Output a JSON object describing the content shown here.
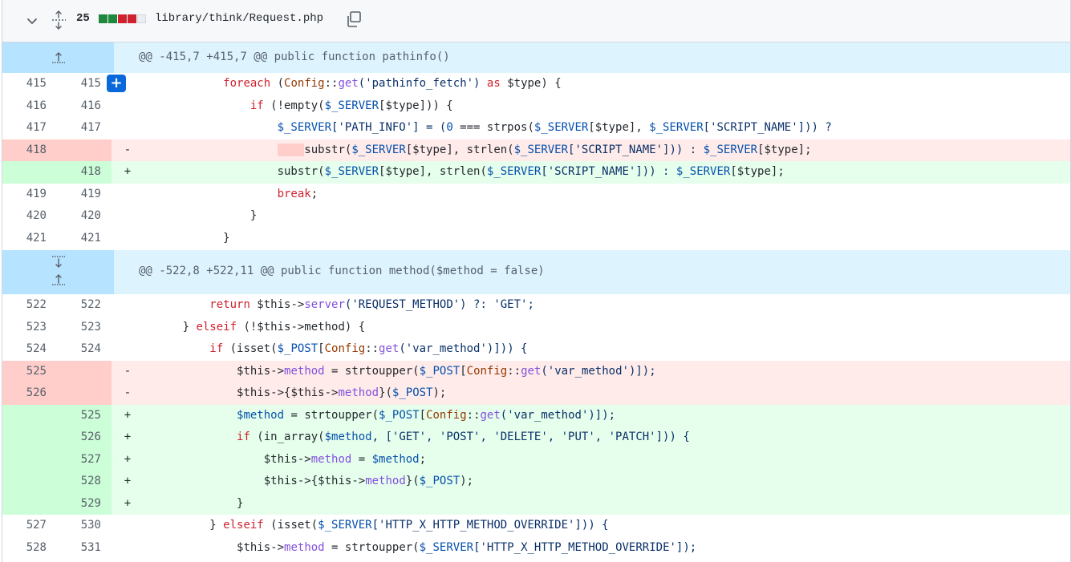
{
  "file": {
    "additions_deletions_count": "25",
    "path": "library/think/Request.php",
    "diffstat_colors": [
      "#1f883d",
      "#1f883d",
      "#cf222e",
      "#cf222e",
      "#d0d7de"
    ]
  },
  "hunks": [
    {
      "header": "@@ -415,7 +415,7 @@ public function pathinfo()",
      "lines": [
        {
          "type": "ctx",
          "old": "415",
          "new": "415",
          "marker": ""
        },
        {
          "type": "ctx",
          "old": "416",
          "new": "416",
          "marker": ""
        },
        {
          "type": "ctx",
          "old": "417",
          "new": "417",
          "marker": ""
        },
        {
          "type": "del",
          "old": "418",
          "new": "",
          "marker": "-"
        },
        {
          "type": "add",
          "old": "",
          "new": "418",
          "marker": "+"
        },
        {
          "type": "ctx",
          "old": "419",
          "new": "419",
          "marker": ""
        },
        {
          "type": "ctx",
          "old": "420",
          "new": "420",
          "marker": ""
        },
        {
          "type": "ctx",
          "old": "421",
          "new": "421",
          "marker": ""
        }
      ]
    },
    {
      "header": "@@ -522,8 +522,11 @@ public function method($method = false)",
      "lines": [
        {
          "type": "ctx",
          "old": "522",
          "new": "522",
          "marker": ""
        },
        {
          "type": "ctx",
          "old": "523",
          "new": "523",
          "marker": ""
        },
        {
          "type": "ctx",
          "old": "524",
          "new": "524",
          "marker": ""
        },
        {
          "type": "del",
          "old": "525",
          "new": "",
          "marker": "-"
        },
        {
          "type": "del",
          "old": "526",
          "new": "",
          "marker": "-"
        },
        {
          "type": "add",
          "old": "",
          "new": "525",
          "marker": "+"
        },
        {
          "type": "add",
          "old": "",
          "new": "526",
          "marker": "+"
        },
        {
          "type": "add",
          "old": "",
          "new": "527",
          "marker": "+"
        },
        {
          "type": "add",
          "old": "",
          "new": "528",
          "marker": "+"
        },
        {
          "type": "add",
          "old": "",
          "new": "529",
          "marker": "+"
        },
        {
          "type": "ctx",
          "old": "527",
          "new": "530",
          "marker": ""
        },
        {
          "type": "ctx",
          "old": "528",
          "new": "531",
          "marker": ""
        }
      ]
    }
  ],
  "code": {
    "h1_l1": {
      "t1": "foreach",
      "t2": " (",
      "t3": "Config",
      "t4": "::",
      "t5": "get",
      "t6": "('pathinfo_fetch') ",
      "t7": "as",
      "t8": " $type) {"
    },
    "h1_l2": {
      "t1": "if",
      "t2": " (!empty(",
      "t3": "$_SERVER",
      "t4": "[$type])) {"
    },
    "h1_l3": {
      "t1": "$_SERVER",
      "t2": "['PATH_INFO'] = (",
      "t3": "0",
      "t4": " === strpos(",
      "t5": "$_SERVER",
      "t6": "[$type], ",
      "t7": "$_SERVER",
      "t8": "['SCRIPT_NAME'])) ?"
    },
    "h1_l4": {
      "t0": "    ",
      "t1": "substr(",
      "t2": "$_SERVER",
      "t3": "[$type], strlen(",
      "t4": "$_SERVER",
      "t5": "['SCRIPT_NAME'])) : ",
      "t6": "$_SERVER",
      "t7": "[$type];"
    },
    "h1_l5": {
      "t1": "substr(",
      "t2": "$_SERVER",
      "t3": "[$type], strlen(",
      "t4": "$_SERVER",
      "t5": "['SCRIPT_NAME'])) : ",
      "t6": "$_SERVER",
      "t7": "[$type];"
    },
    "h1_l6": {
      "t1": "break",
      "t2": ";"
    },
    "h1_l7": {
      "t1": "}"
    },
    "h1_l8": {
      "t1": "}"
    },
    "h2_l1": {
      "t1": "return",
      "t2": " $this->",
      "t3": "server",
      "t4": "('REQUEST_METHOD') ?: 'GET';"
    },
    "h2_l2": {
      "t1": "} ",
      "t2": "elseif",
      "t3": " (!$this->method) {"
    },
    "h2_l3": {
      "t1": "if",
      "t2": " (isset(",
      "t3": "$_POST",
      "t4": "[",
      "t5": "Config",
      "t6": "::",
      "t7": "get",
      "t8": "('var_method')])) {"
    },
    "h2_l4": {
      "t1": "$this->",
      "t2": "method",
      "t3": " = strtoupper(",
      "t4": "$_POST",
      "t5": "[",
      "t6": "Config",
      "t7": "::",
      "t8": "get",
      "t9": "('var_method')]);"
    },
    "h2_l5": {
      "t1": "$this->",
      "t2": "{",
      "t3": "$this->",
      "t4": "method",
      "t5": "}(",
      "t6": "$_POST",
      "t7": ");"
    },
    "h2_l6": {
      "t1": "$method",
      "t2": " = strtoupper(",
      "t3": "$_POST",
      "t4": "[",
      "t5": "Config",
      "t6": "::",
      "t7": "get",
      "t8": "('var_method')]);"
    },
    "h2_l7": {
      "t1": "if",
      "t2": " (in_array(",
      "t3": "$method",
      "t4": ", ['GET', 'POST', 'DELETE', 'PUT', 'PATCH'])) {"
    },
    "h2_l8": {
      "t1": "$this->",
      "t2": "method",
      "t3": " = ",
      "t4": "$method",
      ";": ";",
      "t5": ";"
    },
    "h2_l9": {
      "t1": "$this->",
      "t2": "{",
      "t3": "$this->",
      "t4": "method",
      "t5": "}(",
      "t6": "$_POST",
      "t7": ");"
    },
    "h2_l10": {
      "t1": "}"
    },
    "h2_l11": {
      "t1": "} ",
      "t2": "elseif",
      "t3": " (isset(",
      "t4": "$_SERVER",
      "t5": "['HTTP_X_HTTP_METHOD_OVERRIDE'])) {"
    },
    "h2_l12": {
      "t1": "$this->",
      "t2": "method",
      "t3": " = strtoupper(",
      "t4": "$_SERVER",
      "t5": "['HTTP_X_HTTP_METHOD_OVERRIDE']);"
    }
  }
}
